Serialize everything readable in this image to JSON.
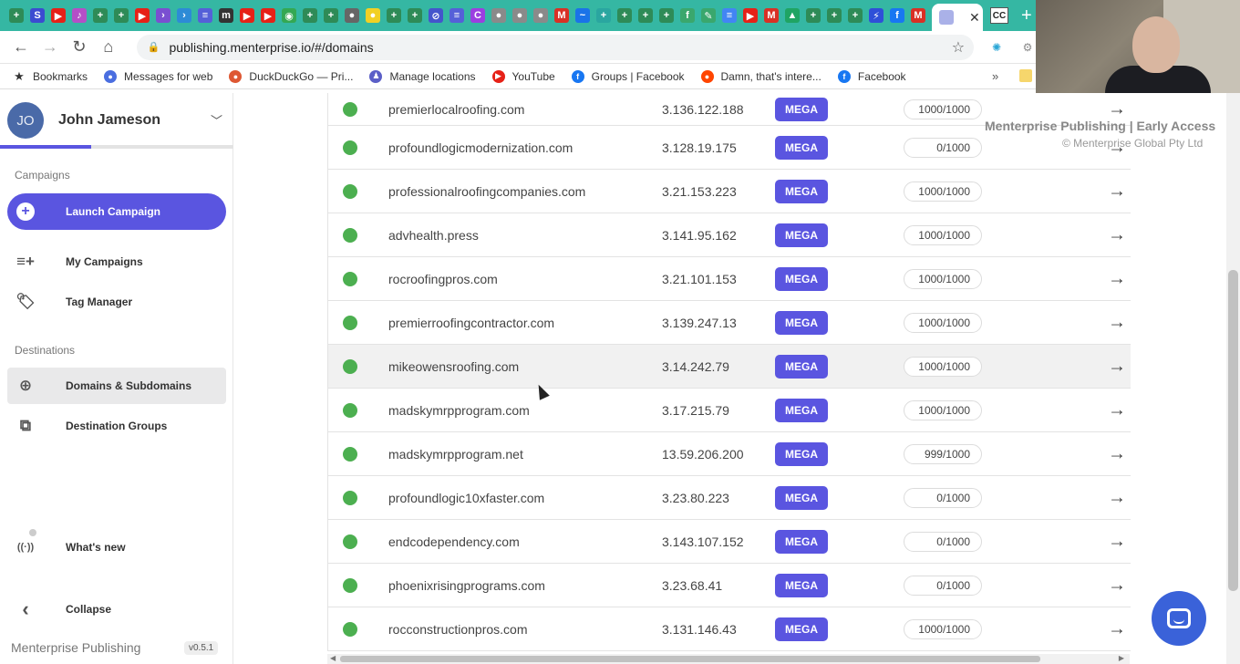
{
  "browser": {
    "favicons": [
      {
        "name": "plus-icon",
        "glyph": "+",
        "color": "#2e8b57"
      },
      {
        "name": "s-icon",
        "glyph": "S",
        "color": "#3b4bd1"
      },
      {
        "name": "youtube-icon",
        "glyph": "▶",
        "color": "#e62117"
      },
      {
        "name": "music-icon",
        "glyph": "♪",
        "color": "#b44fc7"
      },
      {
        "name": "plus-icon",
        "glyph": "+",
        "color": "#2e8b57"
      },
      {
        "name": "plus-icon",
        "glyph": "+",
        "color": "#2e8b57"
      },
      {
        "name": "youtube-icon",
        "glyph": "▶",
        "color": "#e62117"
      },
      {
        "name": "arrow-icon",
        "glyph": "›",
        "color": "#7a4fd1"
      },
      {
        "name": "arrow-icon",
        "glyph": "›",
        "color": "#2d8bd6"
      },
      {
        "name": "list-icon",
        "glyph": "≡",
        "color": "#5560d8"
      },
      {
        "name": "mt-icon",
        "glyph": "m",
        "color": "#333333"
      },
      {
        "name": "youtube-icon",
        "glyph": "▶",
        "color": "#e62117"
      },
      {
        "name": "youtube-icon",
        "glyph": "▶",
        "color": "#e62117"
      },
      {
        "name": "maps-icon",
        "glyph": "◉",
        "color": "#34a853"
      },
      {
        "name": "plus-icon",
        "glyph": "+",
        "color": "#2e8b57"
      },
      {
        "name": "plus-icon",
        "glyph": "+",
        "color": "#2e8b57"
      },
      {
        "name": "disc-icon",
        "glyph": "●",
        "color": "#666666"
      },
      {
        "name": "sun-icon",
        "glyph": "●",
        "color": "#f2d024"
      },
      {
        "name": "plus-icon",
        "glyph": "+",
        "color": "#2e8b57"
      },
      {
        "name": "plus-icon",
        "glyph": "+",
        "color": "#2e8b57"
      },
      {
        "name": "slash-icon",
        "glyph": "⊘",
        "color": "#4455cc"
      },
      {
        "name": "list-icon",
        "glyph": "≡",
        "color": "#5560d8"
      },
      {
        "name": "c-icon",
        "glyph": "C",
        "color": "#9b3fe0"
      },
      {
        "name": "grey-icon",
        "glyph": "●",
        "color": "#8a8a8a"
      },
      {
        "name": "grey-icon",
        "glyph": "●",
        "color": "#8a8a8a"
      },
      {
        "name": "grey-icon",
        "glyph": "●",
        "color": "#8a8a8a"
      },
      {
        "name": "gmail-icon",
        "glyph": "M",
        "color": "#d93025"
      },
      {
        "name": "swoosh-icon",
        "glyph": "~",
        "color": "#1a73e8"
      },
      {
        "name": "plus-icon",
        "glyph": "+",
        "color": "#2aa6a0"
      },
      {
        "name": "plus-icon",
        "glyph": "+",
        "color": "#2e8b57"
      },
      {
        "name": "plus-icon",
        "glyph": "+",
        "color": "#2e8b57"
      },
      {
        "name": "plus-icon",
        "glyph": "+",
        "color": "#2e8b57"
      },
      {
        "name": "fn-icon",
        "glyph": "f",
        "color": "#3aa76d"
      },
      {
        "name": "pen-icon",
        "glyph": "✎",
        "color": "#3aa76d"
      },
      {
        "name": "docs-icon",
        "glyph": "≡",
        "color": "#4285f4"
      },
      {
        "name": "youtube-icon",
        "glyph": "▶",
        "color": "#e62117"
      },
      {
        "name": "gmail-icon",
        "glyph": "M",
        "color": "#d93025"
      },
      {
        "name": "drive-icon",
        "glyph": "▲",
        "color": "#1fa463"
      },
      {
        "name": "plus-icon",
        "glyph": "+",
        "color": "#2e8b57"
      },
      {
        "name": "plus-icon",
        "glyph": "+",
        "color": "#2e8b57"
      },
      {
        "name": "plus-icon",
        "glyph": "+",
        "color": "#2e8b57"
      },
      {
        "name": "bolt-icon",
        "glyph": "⚡",
        "color": "#2f4fd8"
      },
      {
        "name": "facebook-icon",
        "glyph": "f",
        "color": "#1877f2"
      },
      {
        "name": "gmail-icon",
        "glyph": "M",
        "color": "#d93025"
      }
    ],
    "tab_close": "✕",
    "tab_cc": "CC",
    "new_tab": "+",
    "url": "publishing.menterprise.io/#/domains",
    "bookmarks": [
      {
        "label": "Bookmarks",
        "icon": "star-icon",
        "color": "#333333",
        "glyph": "★"
      },
      {
        "label": "Messages for web",
        "icon": "messages-icon",
        "color": "#4a6ee0",
        "glyph": "●"
      },
      {
        "label": "DuckDuckGo — Pri...",
        "icon": "duckduckgo-icon",
        "color": "#de5833",
        "glyph": "●"
      },
      {
        "label": "Manage locations",
        "icon": "locations-icon",
        "color": "#5b5fc7",
        "glyph": "♟"
      },
      {
        "label": "YouTube",
        "icon": "youtube-icon",
        "color": "#e62117",
        "glyph": "▶"
      },
      {
        "label": "Groups | Facebook",
        "icon": "facebook-icon",
        "color": "#1877f2",
        "glyph": "f"
      },
      {
        "label": "Damn, that's intere...",
        "icon": "reddit-icon",
        "color": "#ff4500",
        "glyph": "●"
      },
      {
        "label": "Facebook",
        "icon": "facebook-icon",
        "color": "#1877f2",
        "glyph": "f"
      }
    ],
    "bookmarks_more": "»"
  },
  "sidebar": {
    "user": {
      "initials": "JO",
      "name": "John Jameson"
    },
    "sections": {
      "campaigns": "Campaigns",
      "destinations": "Destinations"
    },
    "launch_label": "Launch Campaign",
    "items": [
      {
        "label": "My Campaigns",
        "icon": "playlist-add-icon",
        "glyph": "≡+"
      },
      {
        "label": "Tag Manager",
        "icon": "tags-icon",
        "glyph": "🏷"
      },
      {
        "label": "Domains & Subdomains",
        "icon": "globe-icon",
        "glyph": "⊕"
      },
      {
        "label": "Destination Groups",
        "icon": "groups-icon",
        "glyph": "⧉"
      },
      {
        "label": "What's new",
        "icon": "broadcast-icon",
        "glyph": "((·))"
      },
      {
        "label": "Collapse",
        "icon": "chevron-left-icon",
        "glyph": "‹"
      }
    ],
    "brand": "Menterprise Publishing",
    "version": "v0.5.1"
  },
  "domains": [
    {
      "domain": "premierlocalroofing.com",
      "ip": "3.136.122.188",
      "tier": "MEGA",
      "quota": "1000/1000"
    },
    {
      "domain": "profoundlogicmodernization.com",
      "ip": "3.128.19.175",
      "tier": "MEGA",
      "quota": "0/1000"
    },
    {
      "domain": "professionalroofingcompanies.com",
      "ip": "3.21.153.223",
      "tier": "MEGA",
      "quota": "1000/1000"
    },
    {
      "domain": "advhealth.press",
      "ip": "3.141.95.162",
      "tier": "MEGA",
      "quota": "1000/1000"
    },
    {
      "domain": "rocroofingpros.com",
      "ip": "3.21.101.153",
      "tier": "MEGA",
      "quota": "1000/1000"
    },
    {
      "domain": "premierroofingcontractor.com",
      "ip": "3.139.247.13",
      "tier": "MEGA",
      "quota": "1000/1000"
    },
    {
      "domain": "mikeowensroofing.com",
      "ip": "3.14.242.79",
      "tier": "MEGA",
      "quota": "1000/1000"
    },
    {
      "domain": "madskymrpprogram.com",
      "ip": "3.17.215.79",
      "tier": "MEGA",
      "quota": "1000/1000"
    },
    {
      "domain": "madskymrpprogram.net",
      "ip": "13.59.206.200",
      "tier": "MEGA",
      "quota": "999/1000"
    },
    {
      "domain": "profoundlogic10xfaster.com",
      "ip": "3.23.80.223",
      "tier": "MEGA",
      "quota": "0/1000"
    },
    {
      "domain": "endcodependency.com",
      "ip": "3.143.107.152",
      "tier": "MEGA",
      "quota": "0/1000"
    },
    {
      "domain": "phoenixrisingprograms.com",
      "ip": "3.23.68.41",
      "tier": "MEGA",
      "quota": "0/1000"
    },
    {
      "domain": "rocconstructionpros.com",
      "ip": "3.131.146.43",
      "tier": "MEGA",
      "quota": "1000/1000"
    }
  ],
  "row_arrow": "→",
  "watermark": {
    "title": "Menterprise Publishing | Early Access",
    "subtitle": "© Menterprise Global Pty Ltd"
  },
  "colors": {
    "accent": "#5a55e0",
    "status_online": "#4caf50",
    "tab_strip": "#35b7a3",
    "chat": "#3a62d9"
  }
}
